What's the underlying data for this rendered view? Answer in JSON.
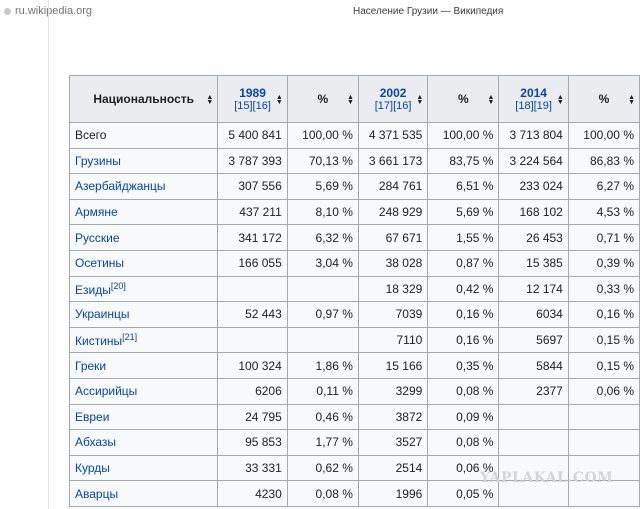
{
  "browser": {
    "url": "ru.wikipedia.org",
    "page_title": "Население Грузии — Википедия"
  },
  "table": {
    "headers": [
      {
        "label": "Национальность"
      },
      {
        "year": "1989",
        "refs": "[15][16]"
      },
      {
        "label": "%"
      },
      {
        "year": "2002",
        "refs": "[17][16]"
      },
      {
        "label": "%"
      },
      {
        "year": "2014",
        "refs": "[18][19]"
      },
      {
        "label": "%"
      }
    ],
    "rows": [
      {
        "name": "Всего",
        "link": false,
        "sup": "",
        "v1989": "5 400 841",
        "p1989": "100,00 %",
        "v2002": "4 371 535",
        "p2002": "100,00 %",
        "v2014": "3 713 804",
        "p2014": "100,00 %"
      },
      {
        "name": "Грузины",
        "link": true,
        "sup": "",
        "v1989": "3 787 393",
        "p1989": "70,13 %",
        "v2002": "3 661 173",
        "p2002": "83,75 %",
        "v2014": "3 224 564",
        "p2014": "86,83 %"
      },
      {
        "name": "Азербайджанцы",
        "link": true,
        "sup": "",
        "v1989": "307 556",
        "p1989": "5,69 %",
        "v2002": "284 761",
        "p2002": "6,51 %",
        "v2014": "233 024",
        "p2014": "6,27 %"
      },
      {
        "name": "Армяне",
        "link": true,
        "sup": "",
        "v1989": "437 211",
        "p1989": "8,10 %",
        "v2002": "248 929",
        "p2002": "5,69 %",
        "v2014": "168 102",
        "p2014": "4,53 %"
      },
      {
        "name": "Русские",
        "link": true,
        "sup": "",
        "v1989": "341 172",
        "p1989": "6,32 %",
        "v2002": "67 671",
        "p2002": "1,55 %",
        "v2014": "26 453",
        "p2014": "0,71 %"
      },
      {
        "name": "Осетины",
        "link": true,
        "sup": "",
        "v1989": "166 055",
        "p1989": "3,04 %",
        "v2002": "38 028",
        "p2002": "0,87 %",
        "v2014": "15 385",
        "p2014": "0,39 %"
      },
      {
        "name": "Езиды",
        "link": true,
        "sup": "[20]",
        "v1989": "",
        "p1989": "",
        "v2002": "18 329",
        "p2002": "0,42 %",
        "v2014": "12 174",
        "p2014": "0,33 %"
      },
      {
        "name": "Украинцы",
        "link": true,
        "sup": "",
        "v1989": "52 443",
        "p1989": "0,97 %",
        "v2002": "7039",
        "p2002": "0,16 %",
        "v2014": "6034",
        "p2014": "0,16 %"
      },
      {
        "name": "Кистины",
        "link": true,
        "sup": "[21]",
        "v1989": "",
        "p1989": "",
        "v2002": "7110",
        "p2002": "0,16 %",
        "v2014": "5697",
        "p2014": "0,15 %"
      },
      {
        "name": "Греки",
        "link": true,
        "sup": "",
        "v1989": "100 324",
        "p1989": "1,86 %",
        "v2002": "15 166",
        "p2002": "0,35 %",
        "v2014": "5844",
        "p2014": "0,15 %"
      },
      {
        "name": "Ассирийцы",
        "link": true,
        "sup": "",
        "v1989": "6206",
        "p1989": "0,11 %",
        "v2002": "3299",
        "p2002": "0,08 %",
        "v2014": "2377",
        "p2014": "0,06 %"
      },
      {
        "name": "Евреи",
        "link": true,
        "sup": "",
        "v1989": "24 795",
        "p1989": "0,46 %",
        "v2002": "3872",
        "p2002": "0,09 %",
        "v2014": "",
        "p2014": ""
      },
      {
        "name": "Абхазы",
        "link": true,
        "sup": "",
        "v1989": "95 853",
        "p1989": "1,77 %",
        "v2002": "3527",
        "p2002": "0,08 %",
        "v2014": "",
        "p2014": ""
      },
      {
        "name": "Курды",
        "link": true,
        "sup": "",
        "v1989": "33 331",
        "p1989": "0,62 %",
        "v2002": "2514",
        "p2002": "0,06 %",
        "v2014": "",
        "p2014": ""
      },
      {
        "name": "Аварцы",
        "link": true,
        "sup": "",
        "v1989": "4230",
        "p1989": "0,08 %",
        "v2002": "1996",
        "p2002": "0,05 %",
        "v2014": "",
        "p2014": ""
      }
    ]
  },
  "watermark": "YAPLAKAL.COM"
}
